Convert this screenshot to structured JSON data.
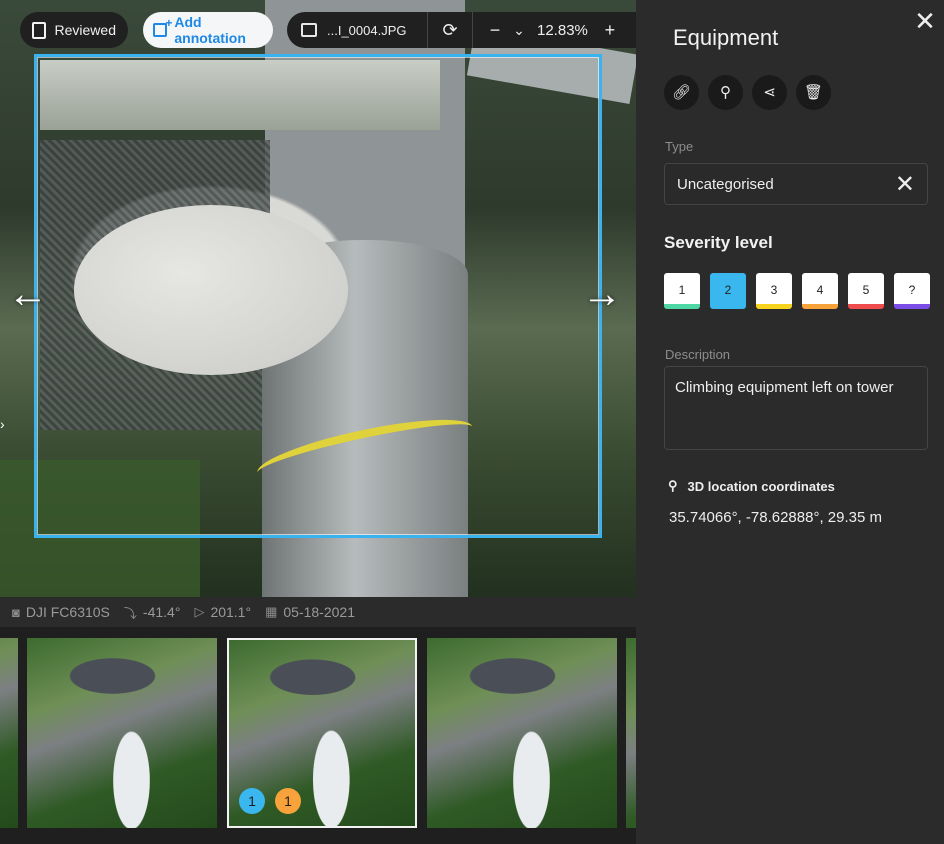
{
  "toolbar": {
    "reviewed_label": "Reviewed",
    "add_annotation_label": "Add annotation",
    "filename": "...I_0004.JPG",
    "zoom_level": "12.83%"
  },
  "meta": {
    "camera": "DJI FC6310S",
    "gimbal_pitch": "-41.4°",
    "heading": "201.1°",
    "date": "05-18-2021"
  },
  "thumbnails": [
    {
      "badges": []
    },
    {
      "selected": true,
      "badges": [
        {
          "label": "1",
          "color": "#3bb7ef"
        },
        {
          "label": "1",
          "color": "#f7a23b"
        }
      ]
    },
    {
      "badges": []
    }
  ],
  "panel": {
    "title": "Equipment",
    "actions": [
      "link-icon",
      "location-pin-icon",
      "share-icon",
      "trash-icon"
    ],
    "type_label": "Type",
    "type_value": "Uncategorised",
    "severity_title": "Severity level",
    "severity_levels": [
      {
        "label": "1",
        "color": "#4fd6a5"
      },
      {
        "label": "2",
        "color": "#3bb7ef",
        "active": true
      },
      {
        "label": "3",
        "color": "#f6d31f"
      },
      {
        "label": "4",
        "color": "#f7a23b"
      },
      {
        "label": "5",
        "color": "#ef4d4d"
      },
      {
        "label": "?",
        "color": "#7b4ee8"
      }
    ],
    "description_label": "Description",
    "description_value": "Climbing equipment left on tower",
    "location_heading": "3D location coordinates",
    "coordinates": "35.74066°, -78.62888°, 29.35 m"
  },
  "colors": {
    "annotation_box": "#39b2f0",
    "panel_bg": "#2b2b2b",
    "accent_blue": "#1e88e5"
  }
}
